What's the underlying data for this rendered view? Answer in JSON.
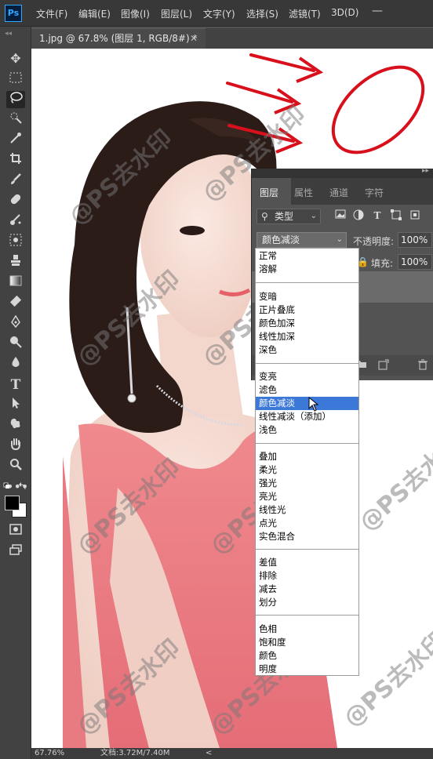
{
  "app": {
    "logo": "Ps"
  },
  "menu": [
    "文件(F)",
    "编辑(E)",
    "图像(I)",
    "图层(L)",
    "文字(Y)",
    "选择(S)",
    "滤镜(T)",
    "3D(D)"
  ],
  "window_controls": {
    "minimize": "—"
  },
  "document_tab": {
    "title": "1.jpg @ 67.8% (图层 1, RGB/8#) *",
    "close": "✕"
  },
  "toolbar": {
    "grip": "◂◂",
    "tools": [
      "move-tool-icon",
      "marquee-tool-icon",
      "lasso-tool-icon",
      "quick-select-tool-icon",
      "eyedropper-tool-icon",
      "crop-tool-icon",
      "brush-tool-icon",
      "healing-tool-icon",
      "patch-tool-icon",
      "stamp-tool-icon",
      "gradient-tool-icon",
      "eraser-tool-icon",
      "pen-tool-icon",
      "dodge-tool-icon",
      "blur-tool-icon",
      "type-tool-icon",
      "path-select-tool-icon",
      "custom-shape-tool-icon",
      "hand-tool-icon",
      "zoom-tool-icon",
      "more-tools-icon"
    ],
    "active_tool": "lasso-tool-icon"
  },
  "layers_panel": {
    "collapse_icon": "▸▸",
    "tabs": [
      "图层",
      "属性",
      "通道",
      "字符"
    ],
    "active_tab": "图层",
    "filter_label": "类型",
    "blend_mode": "颜色减淡",
    "opacity_label": "不透明度:",
    "opacity_value": "100%",
    "lock_label": "锁定:",
    "fill_label": "填充:",
    "fill_value": "100%"
  },
  "blend_dropdown": {
    "groups": [
      [
        "正常",
        "溶解"
      ],
      [
        "变暗",
        "正片叠底",
        "颜色加深",
        "线性加深",
        "深色"
      ],
      [
        "变亮",
        "滤色",
        "颜色减淡",
        "线性减淡（添加）",
        "浅色"
      ],
      [
        "叠加",
        "柔光",
        "强光",
        "亮光",
        "线性光",
        "点光",
        "实色混合"
      ],
      [
        "差值",
        "排除",
        "减去",
        "划分"
      ],
      [
        "色相",
        "饱和度",
        "颜色",
        "明度"
      ]
    ],
    "highlighted": "颜色减淡"
  },
  "canvas": {
    "watermark": "@PS去水印"
  },
  "status": {
    "zoom": "67.76%",
    "doc": "文档:3.72M/7.40M",
    "nav_arrow": "<"
  },
  "colors": {
    "accent": "#3b78d8",
    "annotation_red": "#d8101c",
    "dress_pink": "#e8707a"
  }
}
